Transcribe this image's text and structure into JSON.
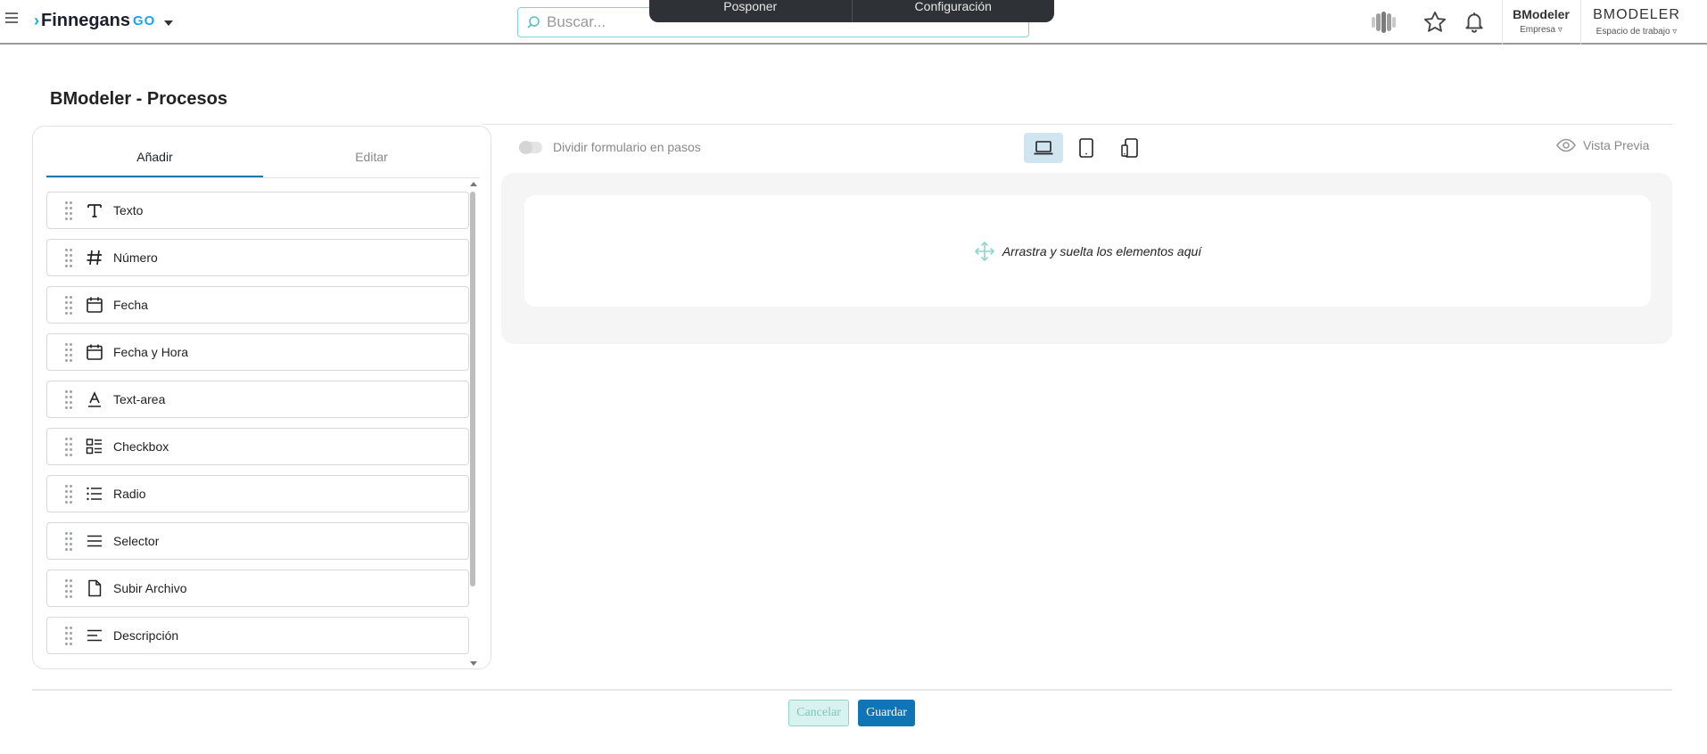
{
  "header": {
    "brand": "Finnegans",
    "brand_suffix": "GO",
    "search_placeholder": "Buscar...",
    "popup_left": "Posponer",
    "popup_right": "Configuración",
    "company_name": "BModeler",
    "company_label": "Empresa ▿",
    "workspace_name": "BMODELER",
    "workspace_label": "Espacio de trabajo ▿"
  },
  "page": {
    "title": "BModeler - Procesos"
  },
  "panel": {
    "tabs": [
      "Añadir",
      "Editar"
    ],
    "items": [
      {
        "label": "Texto",
        "icon": "text-icon"
      },
      {
        "label": "Número",
        "icon": "hash-icon"
      },
      {
        "label": "Fecha",
        "icon": "calendar-icon"
      },
      {
        "label": "Fecha y Hora",
        "icon": "calendar-icon"
      },
      {
        "label": "Text-area",
        "icon": "text-area-icon"
      },
      {
        "label": "Checkbox",
        "icon": "checkbox-list-icon"
      },
      {
        "label": "Radio",
        "icon": "list-icon"
      },
      {
        "label": "Selector",
        "icon": "menu-icon"
      },
      {
        "label": "Subir Archivo",
        "icon": "file-icon"
      },
      {
        "label": "Descripción",
        "icon": "align-left-icon"
      }
    ]
  },
  "toolbar": {
    "split_label": "Dividir formulario en pasos",
    "preview_label": "Vista Previa"
  },
  "canvas": {
    "drop_text": "Arrastra y suelta los elementos aquí"
  },
  "footer": {
    "cancel_label": "Cancelar",
    "save_label": "Guardar"
  },
  "colors": {
    "accent": "#0f75b4",
    "search_border": "#7fd3d5",
    "active_device_bg": "#cfe6f0"
  }
}
